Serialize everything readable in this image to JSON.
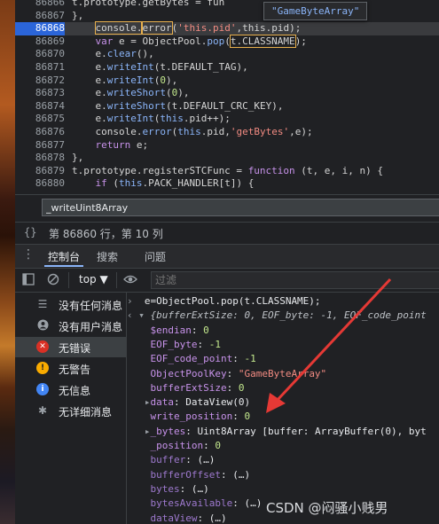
{
  "editor": {
    "tooltip": "\"GameByteArray\"",
    "lines": [
      {
        "num": "86867",
        "segs": [
          [
            "",
            "},"
          ]
        ]
      },
      {
        "num": "86868",
        "segs": [
          [
            "",
            "    "
          ],
          [
            "hl",
            "console."
          ],
          [
            "hl",
            "error"
          ],
          [
            "",
            "("
          ],
          [
            "str",
            "'this.pid'"
          ],
          [
            "",
            ","
          ],
          [
            "prop",
            "this.pid"
          ],
          [
            "",
            ");"
          ]
        ]
      },
      {
        "num": "86869",
        "segs": [
          [
            "kw",
            "    var"
          ],
          [
            "",
            " e = ObjectPool."
          ],
          [
            "fn",
            "pop"
          ],
          [
            "",
            "("
          ],
          [
            "hl",
            "t.CLASSNAME"
          ],
          [
            "",
            ");"
          ]
        ]
      },
      {
        "num": "86870",
        "segs": [
          [
            "",
            "    e."
          ],
          [
            "fn",
            "clear"
          ],
          [
            "",
            "(),"
          ]
        ]
      },
      {
        "num": "86871",
        "segs": [
          [
            "",
            "    e."
          ],
          [
            "fn",
            "writeInt"
          ],
          [
            "",
            "(t.DEFAULT_TAG),"
          ]
        ]
      },
      {
        "num": "86872",
        "segs": [
          [
            "",
            "    e."
          ],
          [
            "fn",
            "writeInt"
          ],
          [
            "",
            "("
          ],
          [
            "num",
            "0"
          ],
          [
            "",
            "),"
          ]
        ]
      },
      {
        "num": "86873",
        "segs": [
          [
            "",
            "    e."
          ],
          [
            "fn",
            "writeShort"
          ],
          [
            "",
            "("
          ],
          [
            "num",
            "0"
          ],
          [
            "",
            "),"
          ]
        ]
      },
      {
        "num": "86874",
        "segs": [
          [
            "",
            "    e."
          ],
          [
            "fn",
            "writeShort"
          ],
          [
            "",
            "(t.DEFAULT_CRC_KEY),"
          ]
        ]
      },
      {
        "num": "86875",
        "segs": [
          [
            "",
            "    e."
          ],
          [
            "fn",
            "writeInt"
          ],
          [
            "",
            "("
          ],
          [
            "kw2",
            "this"
          ],
          [
            "",
            ".pid++);"
          ]
        ]
      },
      {
        "num": "86876",
        "segs": [
          [
            "",
            "    console."
          ],
          [
            "fn",
            "error"
          ],
          [
            "",
            "("
          ],
          [
            "kw2",
            "this"
          ],
          [
            "",
            ".pid,"
          ],
          [
            "str",
            "'getBytes'"
          ],
          [
            "",
            ",e);"
          ]
        ]
      },
      {
        "num": "86877",
        "segs": [
          [
            "kw",
            "    return"
          ],
          [
            "",
            " e;"
          ]
        ]
      },
      {
        "num": "86878",
        "segs": [
          [
            "",
            "},"
          ]
        ]
      },
      {
        "num": "86879",
        "segs": [
          [
            "",
            "t.prototype.registerSTCFunc = "
          ],
          [
            "kw",
            "function"
          ],
          [
            "",
            " (t, e, i, n) {"
          ]
        ]
      },
      {
        "num": "86880",
        "segs": [
          [
            "kw",
            "    if"
          ],
          [
            "",
            " ("
          ],
          [
            "kw2",
            "this"
          ],
          [
            "",
            ".PACK_HANDLER[t]) {"
          ]
        ]
      },
      {
        "num": "86881",
        "segs": [
          [
            "kw",
            "        if"
          ],
          [
            "",
            " ("
          ],
          [
            "kw2",
            "this"
          ],
          [
            "",
            ".PACK_HANDLER[t][e])"
          ]
        ]
      }
    ],
    "top_line": {
      "num": "86866",
      "segs": [
        [
          "",
          "t.prototype.getBytes = fun"
        ]
      ]
    }
  },
  "search": {
    "value": "_writeUint8Array"
  },
  "status": {
    "braces": "{}",
    "cursor": "第 86860 行，第 10 列"
  },
  "drawer": {
    "menu": "⋮",
    "tabs": [
      {
        "label": "控制台",
        "active": true
      },
      {
        "label": "搜索",
        "active": false
      },
      {
        "label": "问题",
        "active": false
      }
    ]
  },
  "toolbar": {
    "context": "top ▼",
    "filter_placeholder": "过滤"
  },
  "sidebar": {
    "items": [
      {
        "label": "没有任何消息",
        "icon": "list-icon",
        "selected": false
      },
      {
        "label": "没有用户消息",
        "icon": "user-icon",
        "selected": false
      },
      {
        "label": "无错误",
        "icon": "error-icon",
        "selected": true
      },
      {
        "label": "无警告",
        "icon": "warning-icon",
        "selected": false
      },
      {
        "label": "无信息",
        "icon": "info-icon",
        "selected": false
      },
      {
        "label": "无详细消息",
        "icon": "verbose-icon",
        "selected": false
      }
    ]
  },
  "console": {
    "input_line": "e=ObjectPool.pop(t.CLASSNAME);",
    "object_preview": "{bufferExtSize: 0, EOF_byte: -1, EOF_code_point",
    "props": [
      {
        "k": "$endian",
        "v": "0",
        "t": "num"
      },
      {
        "k": "EOF_byte",
        "v": "-1",
        "t": "num"
      },
      {
        "k": "EOF_code_point",
        "v": "-1",
        "t": "num"
      },
      {
        "k": "ObjectPoolKey",
        "v": "\"GameByteArray\"",
        "t": "str"
      },
      {
        "k": "bufferExtSize",
        "v": "0",
        "t": "num"
      },
      {
        "k": "data",
        "v": "DataView(0)",
        "t": "obj",
        "expand": true
      },
      {
        "k": "write_position",
        "v": "0",
        "t": "num"
      },
      {
        "k": "_bytes",
        "v": "Uint8Array [buffer: ArrayBuffer(0), byt",
        "t": "obj",
        "expand": true
      },
      {
        "k": "_position",
        "v": "0",
        "t": "num"
      },
      {
        "k": "buffer",
        "v": "(…)",
        "t": "obj",
        "dim": true
      },
      {
        "k": "bufferOffset",
        "v": "(…)",
        "t": "obj",
        "dim": true
      },
      {
        "k": "bytes",
        "v": "(…)",
        "t": "obj",
        "dim": true
      },
      {
        "k": "bytesAvailable",
        "v": "(…)",
        "t": "obj",
        "dim": true
      },
      {
        "k": "dataView",
        "v": "(…)",
        "t": "obj",
        "dim": true
      }
    ]
  },
  "watermark": "CSDN @闷骚小贱男",
  "colors": {
    "accent": "#8ab4f8",
    "arrow": "#e53935",
    "error": "#d93025",
    "warning": "#f9ab00",
    "info": "#4285f4"
  }
}
